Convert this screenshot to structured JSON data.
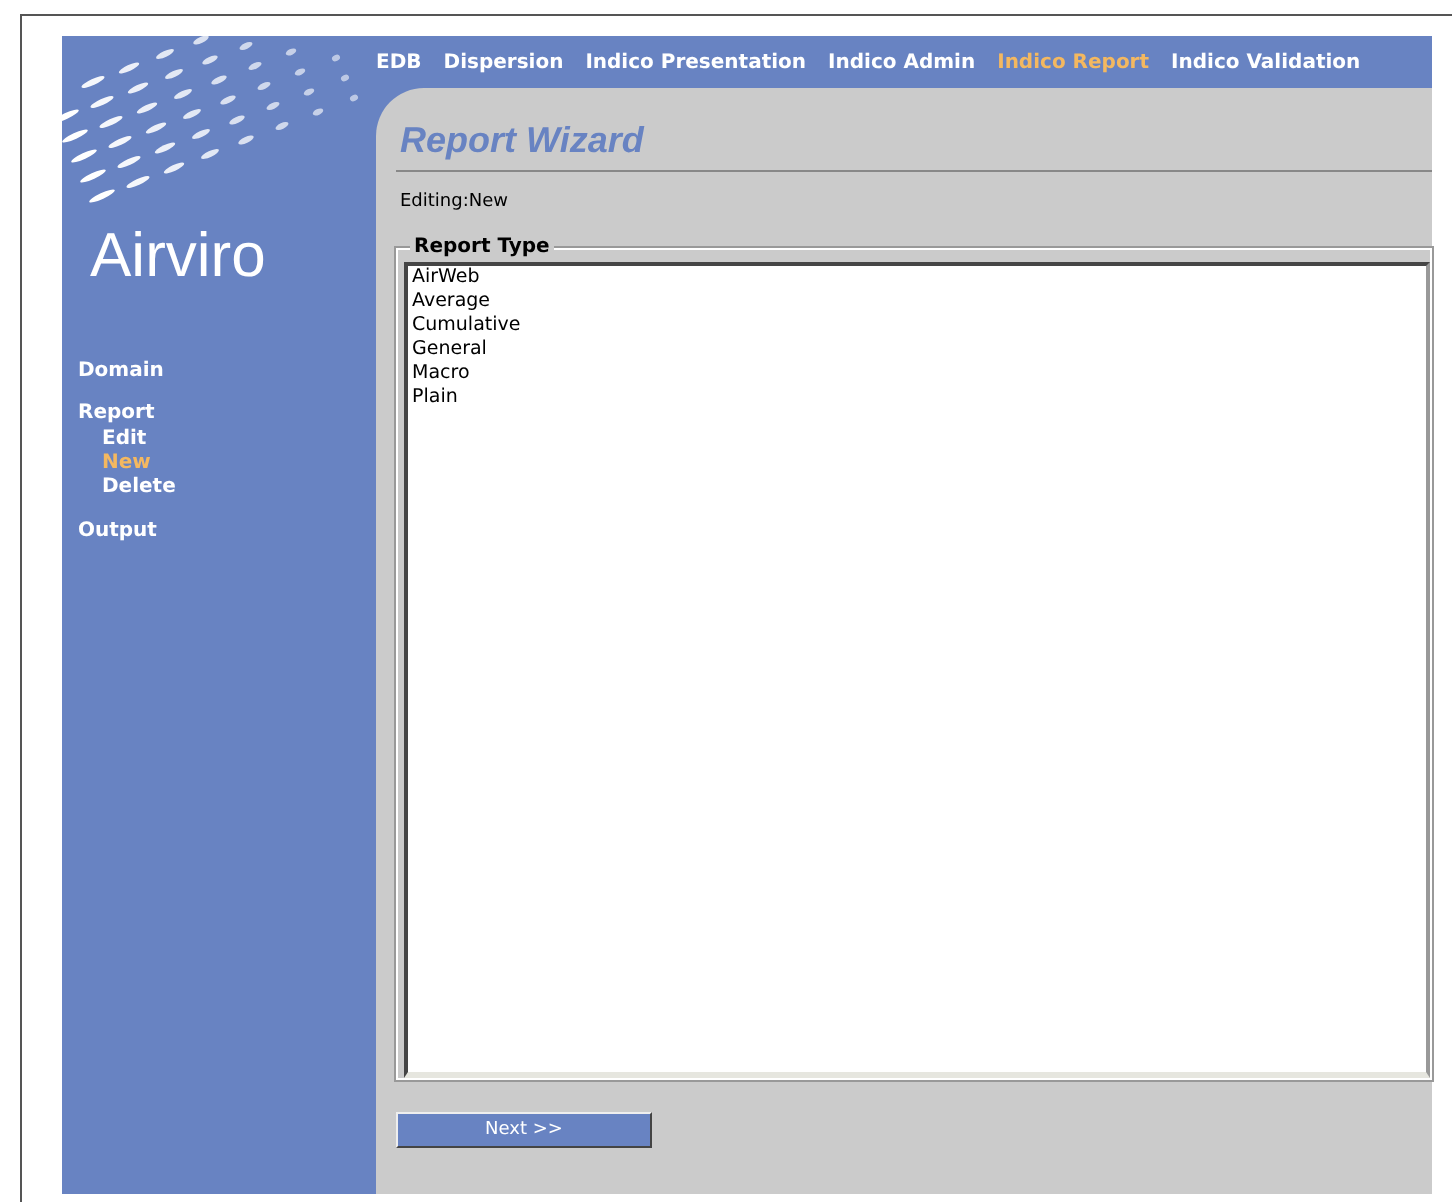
{
  "logo": {
    "text": "Airviro"
  },
  "nav": [
    {
      "label": "EDB",
      "selected": false
    },
    {
      "label": "Dispersion",
      "selected": false
    },
    {
      "label": "Indico Presentation",
      "selected": false
    },
    {
      "label": "Indico Admin",
      "selected": false
    },
    {
      "label": "Indico Report",
      "selected": true
    },
    {
      "label": "Indico Validation",
      "selected": false
    }
  ],
  "sidebar": {
    "items": [
      {
        "label": "Domain",
        "selected": false
      },
      {
        "label": "Report",
        "selected": false,
        "children": [
          {
            "label": "Edit",
            "selected": false
          },
          {
            "label": "New",
            "selected": true
          },
          {
            "label": "Delete",
            "selected": false
          }
        ]
      },
      {
        "label": "Output",
        "selected": false
      }
    ]
  },
  "title": "Report Wizard",
  "editing": "Editing:New",
  "report_type": {
    "legend": "Report Type",
    "options": [
      {
        "label": "AirWeb",
        "selected": false
      },
      {
        "label": "Average",
        "selected": false
      },
      {
        "label": "Cumulative",
        "selected": false
      },
      {
        "label": "General",
        "selected": false
      },
      {
        "label": "Macro",
        "selected": false
      },
      {
        "label": "Plain",
        "selected": false
      }
    ]
  },
  "buttons": [
    {
      "label": "Next >>"
    }
  ]
}
